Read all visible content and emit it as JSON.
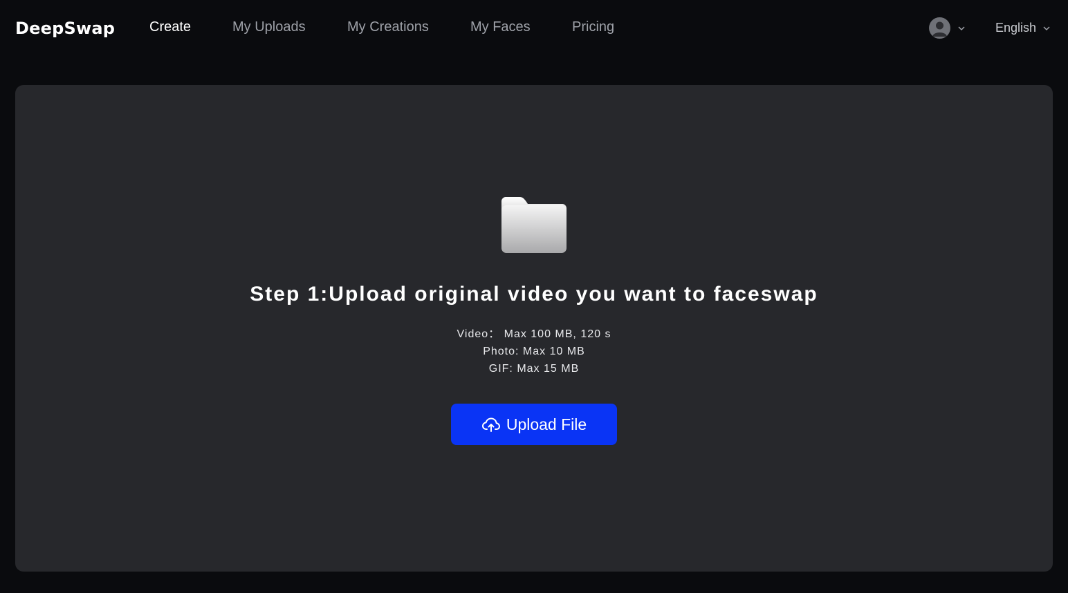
{
  "header": {
    "logo": "DeepSwap",
    "nav": [
      {
        "label": "Create",
        "active": true
      },
      {
        "label": "My Uploads",
        "active": false
      },
      {
        "label": "My Creations",
        "active": false
      },
      {
        "label": "My Faces",
        "active": false
      },
      {
        "label": "Pricing",
        "active": false
      }
    ],
    "account_icon": "user-avatar-icon",
    "language": "English"
  },
  "upload": {
    "icon": "folder-icon",
    "title": "Step 1:Upload original video you want to faceswap",
    "limits": [
      "Video： Max 100 MB, 120 s",
      "Photo: Max 10 MB",
      "GIF: Max 15 MB"
    ],
    "button_label": "Upload File",
    "button_icon": "cloud-upload-icon"
  },
  "colors": {
    "background": "#0a0b0e",
    "card": "#27282c",
    "accent": "#0a34f5",
    "nav_inactive": "#9ea1a8"
  }
}
